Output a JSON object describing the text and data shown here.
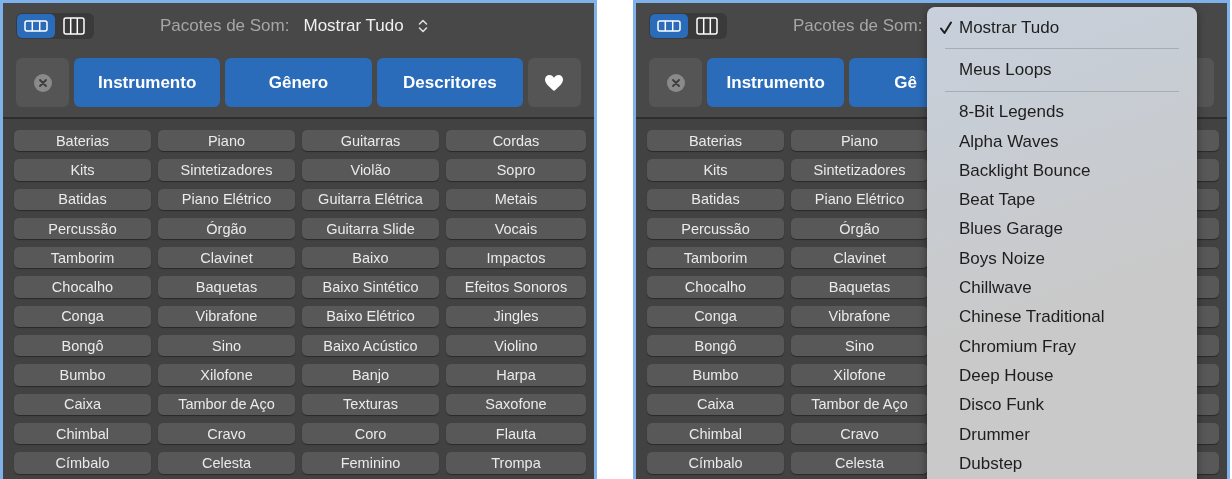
{
  "panels": [
    {
      "view_toggle": [
        {
          "kind": "rows",
          "selected": true
        },
        {
          "kind": "columns",
          "selected": false
        }
      ],
      "sound_packs": {
        "label": "Pacotes de Som:",
        "value": "Mostrar Tudo"
      },
      "filters": [
        {
          "kind": "clear"
        },
        {
          "kind": "tab",
          "label": "Instrumento"
        },
        {
          "kind": "tab",
          "label": "Gênero"
        },
        {
          "kind": "tab",
          "label": "Descritores"
        },
        {
          "kind": "favorites"
        }
      ],
      "keywords": [
        [
          "Baterias",
          "Piano",
          "Guitarras",
          "Cordas"
        ],
        [
          "Kits",
          "Sintetizadores",
          "Violão",
          "Sopro"
        ],
        [
          "Batidas",
          "Piano Elétrico",
          "Guitarra Elétrica",
          "Metais"
        ],
        [
          "Percussão",
          "Órgão",
          "Guitarra Slide",
          "Vocais"
        ],
        [
          "Tamborim",
          "Clavinet",
          "Baixo",
          "Impactos"
        ],
        [
          "Chocalho",
          "Baquetas",
          "Baixo Sintético",
          "Efeitos Sonoros"
        ],
        [
          "Conga",
          "Vibrafone",
          "Baixo Elétrico",
          "Jingles"
        ],
        [
          "Bongô",
          "Sino",
          "Baixo Acústico",
          "Violino"
        ],
        [
          "Bumbo",
          "Xilofone",
          "Banjo",
          "Harpa"
        ],
        [
          "Caixa",
          "Tambor de Aço",
          "Texturas",
          "Saxofone"
        ],
        [
          "Chimbal",
          "Cravo",
          "Coro",
          "Flauta"
        ],
        [
          "Címbalo",
          "Celesta",
          "Feminino",
          "Trompa"
        ]
      ]
    },
    {
      "view_toggle": [
        {
          "kind": "rows",
          "selected": true
        },
        {
          "kind": "columns",
          "selected": false
        }
      ],
      "sound_packs": {
        "label": "Pacotes de Som:"
      },
      "filters": [
        {
          "kind": "clear"
        },
        {
          "kind": "tab",
          "label": "Instrumento"
        },
        {
          "kind": "tab",
          "label": "Gê"
        }
      ],
      "keywords": [
        [
          "Baterias",
          "Piano"
        ],
        [
          "Kits",
          "Sintetizadores"
        ],
        [
          "Batidas",
          "Piano Elétrico"
        ],
        [
          "Percussão",
          "Órgão"
        ],
        [
          "Tamborim",
          "Clavinet"
        ],
        [
          "Chocalho",
          "Baquetas"
        ],
        [
          "Conga",
          "Vibrafone"
        ],
        [
          "Bongô",
          "Sino"
        ],
        [
          "Bumbo",
          "Xilofone"
        ],
        [
          "Caixa",
          "Tambor de Aço"
        ],
        [
          "Chimbal",
          "Cravo"
        ],
        [
          "Címbalo",
          "Celesta"
        ]
      ],
      "menu": {
        "sections": [
          [
            {
              "label": "Mostrar Tudo",
              "selected": true
            }
          ],
          [
            {
              "label": "Meus Loops",
              "selected": false
            }
          ],
          [
            {
              "label": "8-Bit Legends",
              "selected": false
            },
            {
              "label": "Alpha Waves",
              "selected": false
            },
            {
              "label": "Backlight Bounce",
              "selected": false
            },
            {
              "label": "Beat Tape",
              "selected": false
            },
            {
              "label": "Blues Garage",
              "selected": false
            },
            {
              "label": "Boys Noize",
              "selected": false
            },
            {
              "label": "Chillwave",
              "selected": false
            },
            {
              "label": "Chinese Traditional",
              "selected": false
            },
            {
              "label": "Chromium Fray",
              "selected": false
            },
            {
              "label": "Deep House",
              "selected": false
            },
            {
              "label": "Disco Funk",
              "selected": false
            },
            {
              "label": "Drummer",
              "selected": false
            },
            {
              "label": "Dubstep",
              "selected": false
            }
          ]
        ]
      }
    }
  ]
}
